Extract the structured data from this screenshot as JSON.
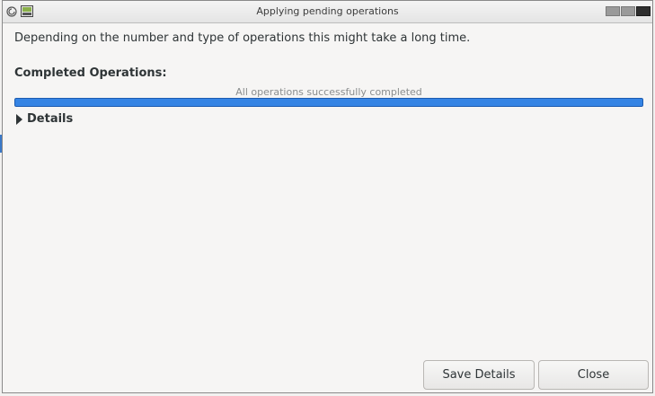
{
  "window": {
    "title": "Applying pending operations",
    "icons": [
      "window-menu-icon",
      "app-icon"
    ],
    "controls": [
      "minimize-button",
      "maximize-button",
      "close-window-button"
    ]
  },
  "dialog": {
    "description": "Depending on the number and type of operations this might take a long time.",
    "completed_heading": "Completed Operations:",
    "progress_text": "All operations successfully completed",
    "progress_fraction": 1.0,
    "details_label": "Details",
    "details_expanded": false
  },
  "buttons": {
    "save_details": "Save Details",
    "close": "Close"
  },
  "colors": {
    "progress": "#3584e4",
    "window_bg": "#f6f5f4"
  }
}
